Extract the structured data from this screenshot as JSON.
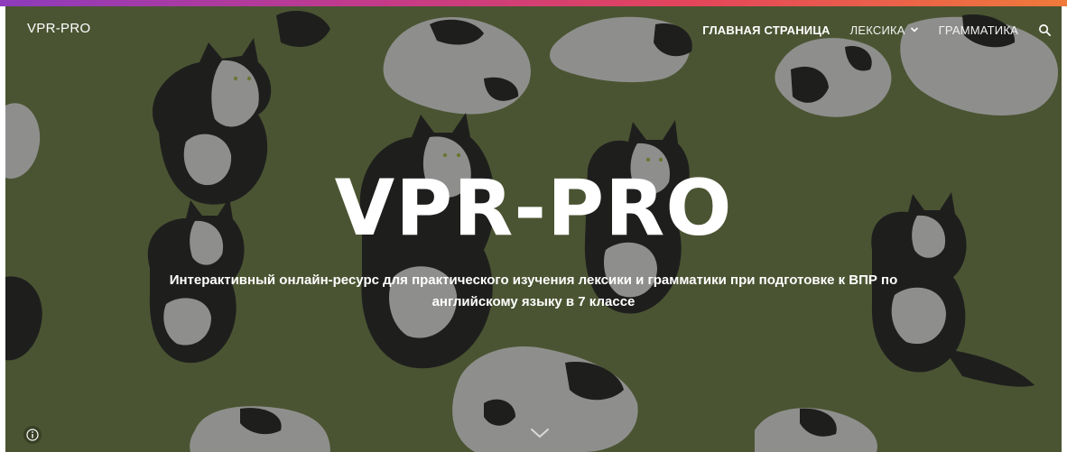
{
  "header": {
    "site_name": "VPR-PRO",
    "nav": [
      {
        "label": "ГЛАВНАЯ СТРАНИЦА",
        "active": true
      },
      {
        "label": "ЛЕКСИКА",
        "has_dropdown": true
      },
      {
        "label": "ГРАММАТИКА"
      }
    ],
    "search_icon": "search-icon"
  },
  "hero": {
    "title": "VPR-PRO",
    "subtitle_line1": "Интерактивный онлайн-ресурс для практического изучения лексики и грамматики при подготовке к ВПР по",
    "subtitle_line2": "английскому языку в 7 классе",
    "background_color": "#566039",
    "info_icon": "info-icon",
    "scroll_icon": "chevron-down-icon"
  },
  "colors": {
    "accent_bar": "#c43a8a",
    "cat_black": "#1f1f1f",
    "cat_gray": "#a8a8a8"
  }
}
